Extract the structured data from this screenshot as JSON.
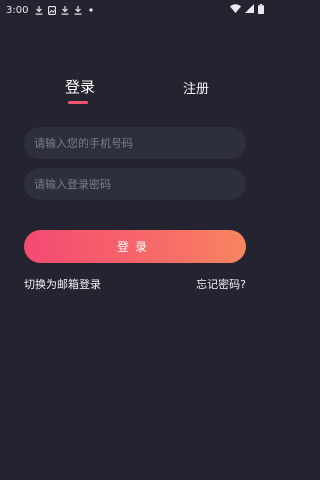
{
  "status_bar": {
    "time": "3:00",
    "left_icons": [
      "download-icon",
      "image-icon",
      "download-icon",
      "download-icon",
      "dot-icon"
    ],
    "right_icons": [
      "wifi-icon",
      "signal-icon",
      "battery-icon"
    ]
  },
  "tabs": {
    "login": "登录",
    "register": "注册"
  },
  "form": {
    "phone_placeholder": "请输入您的手机号码",
    "password_placeholder": "请输入登录密码",
    "login_button": "登录"
  },
  "links": {
    "switch_email": "切换为邮箱登录",
    "forgot_password": "忘记密码?"
  },
  "colors": {
    "background": "#232430",
    "field_background": "#2e2f3e",
    "accent": "#f2536d",
    "button_gradient_start": "#f34a71",
    "button_gradient_end": "#f8855f"
  }
}
